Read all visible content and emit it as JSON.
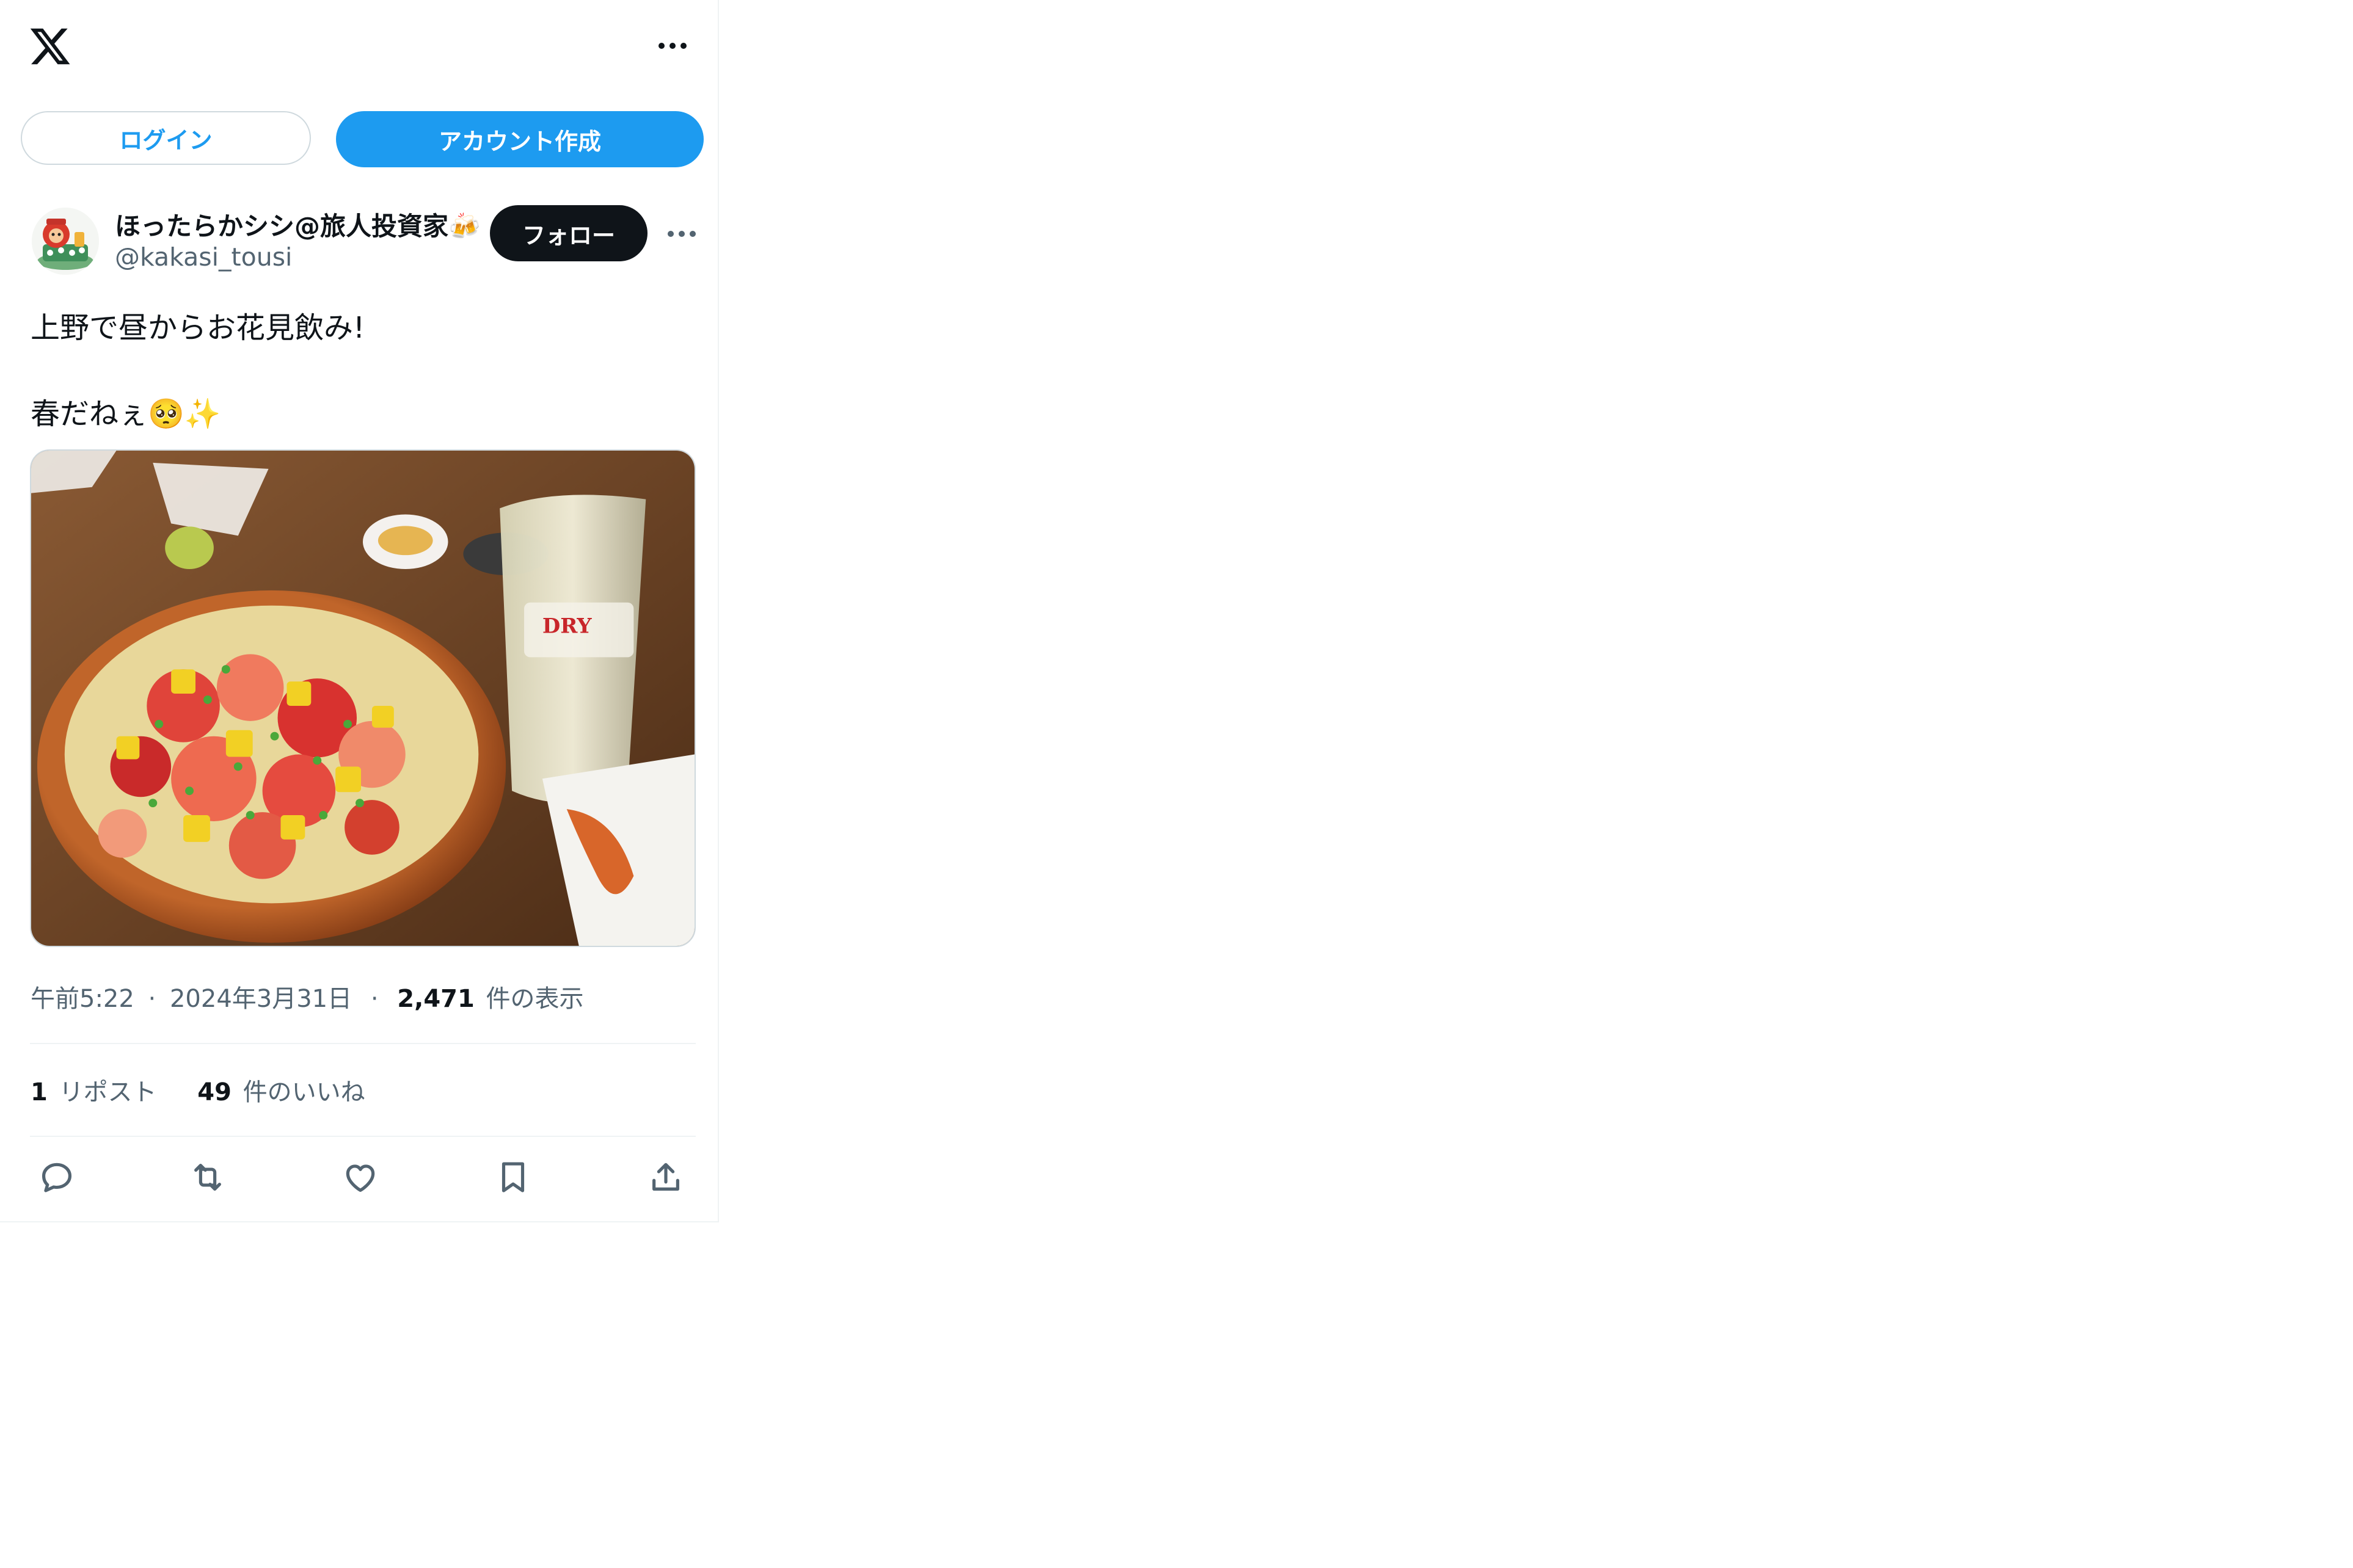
{
  "header": {
    "logo_icon": "x-logo-icon",
    "more_icon": "more-horizontal-icon"
  },
  "auth": {
    "login_label": "ログイン",
    "signup_label": "アカウント作成"
  },
  "post": {
    "author_name": "ほったらかシシ@旅人投資家🍻",
    "author_handle": "@kakasi_tousi",
    "follow_label": "フォロー",
    "text_line1": "上野で昼からお花見飲み!",
    "text_line2": "春だねぇ🥺✨",
    "image_icon": "photo-chirashi-sushi-and-beer",
    "time": "午前5:22",
    "date": "2024年3月31日",
    "sep": "·",
    "views_count": "2,471",
    "views_label": "件の表示",
    "reposts_count": "1",
    "reposts_label": "リポスト",
    "likes_count": "49",
    "likes_label": "件のいいね"
  },
  "actions": {
    "reply_icon": "reply-icon",
    "repost_icon": "repost-icon",
    "like_icon": "heart-icon",
    "bookmark_icon": "bookmark-icon",
    "share_icon": "share-icon"
  },
  "colors": {
    "accent": "#1d9bf0",
    "text": "#0f1419",
    "muted": "#536471",
    "border": "#cfd9de"
  }
}
